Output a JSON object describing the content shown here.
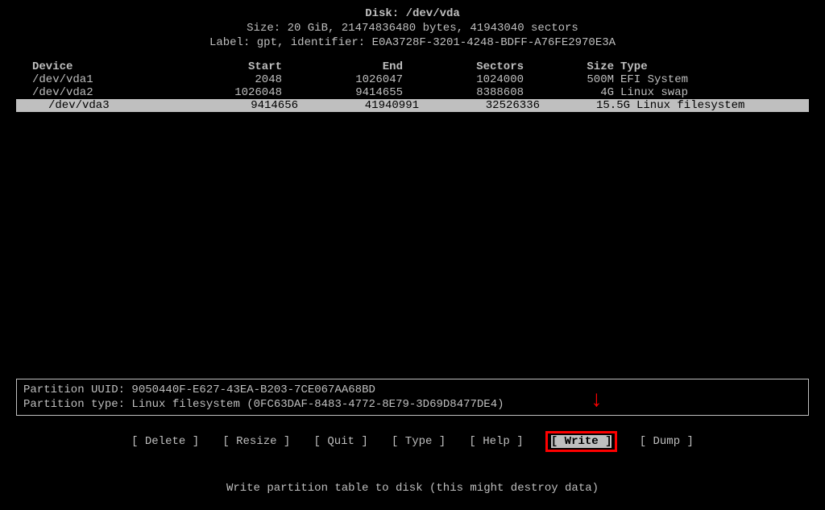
{
  "header": {
    "disk_line": "Disk: /dev/vda",
    "size_line": "Size: 20 GiB, 21474836480 bytes, 41943040 sectors",
    "label_line": "Label: gpt, identifier: E0A3728F-3201-4248-BDFF-A76FE2970E3A"
  },
  "table": {
    "headers": {
      "device": "Device",
      "start": "Start",
      "end": "End",
      "sectors": "Sectors",
      "size": "Size",
      "type": "Type"
    },
    "rows": [
      {
        "device": "/dev/vda1",
        "start": "2048",
        "end": "1026047",
        "sectors": "1024000",
        "size": "500M",
        "type": "EFI System"
      },
      {
        "device": "/dev/vda2",
        "start": "1026048",
        "end": "9414655",
        "sectors": "8388608",
        "size": "4G",
        "type": "Linux swap"
      },
      {
        "device": "/dev/vda3",
        "start": "9414656",
        "end": "41940991",
        "sectors": "32526336",
        "size": "15.5G",
        "type": "Linux filesystem"
      }
    ],
    "selector": ">>"
  },
  "info": {
    "uuid_line": "Partition UUID: 9050440F-E627-43EA-B203-7CE067AA68BD",
    "type_line": "Partition type: Linux filesystem (0FC63DAF-8483-4772-8E79-3D69D8477DE4)"
  },
  "menu": {
    "delete": "[ Delete ]",
    "resize": "[ Resize ]",
    "quit": "[  Quit  ]",
    "type": "[  Type  ]",
    "help": "[  Help  ]",
    "write": "[  Write ]",
    "dump": "[  Dump  ]"
  },
  "footer": {
    "hint": "Write partition table to disk (this might destroy data)"
  }
}
